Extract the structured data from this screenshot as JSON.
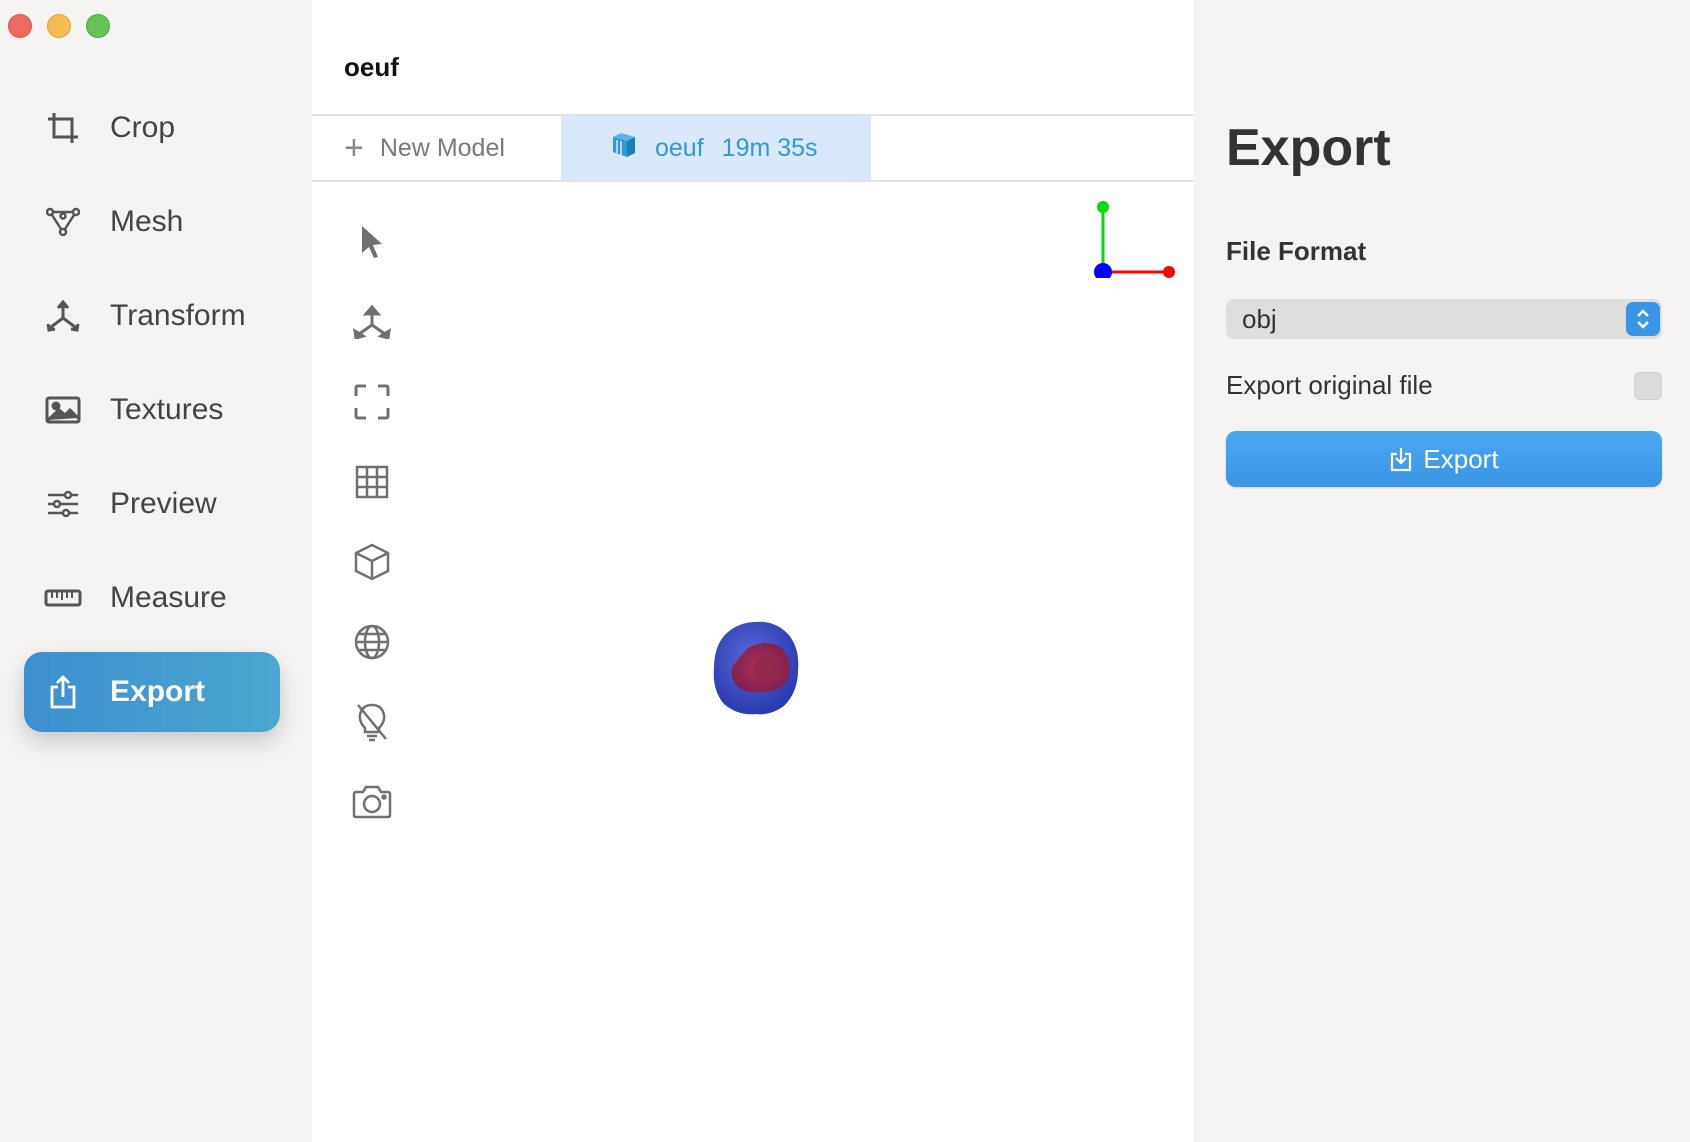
{
  "window": {
    "controls": [
      "close",
      "minimize",
      "zoom"
    ]
  },
  "sidebar": {
    "items": [
      {
        "label": "Crop",
        "icon": "crop-icon"
      },
      {
        "label": "Mesh",
        "icon": "mesh-icon"
      },
      {
        "label": "Transform",
        "icon": "transform-icon"
      },
      {
        "label": "Textures",
        "icon": "image-icon"
      },
      {
        "label": "Preview",
        "icon": "sliders-icon"
      },
      {
        "label": "Measure",
        "icon": "ruler-icon"
      },
      {
        "label": "Export",
        "icon": "share-icon",
        "active": true
      }
    ]
  },
  "main": {
    "title": "oeuf",
    "tabs": {
      "new_label": "New Model",
      "active_name": "oeuf",
      "active_time": "19m 35s"
    },
    "tools": [
      "pointer-icon",
      "transform-tool-icon",
      "frame-icon",
      "grid-icon",
      "cube-icon",
      "globe-icon",
      "light-off-icon",
      "camera-icon"
    ]
  },
  "panel": {
    "title": "Export",
    "file_format_label": "File Format",
    "file_format_value": "obj",
    "export_original_label": "Export original file",
    "export_original_checked": false,
    "export_button_label": "Export"
  },
  "colors": {
    "accent": "#3b95e6",
    "active_nav": "#4aa6cf",
    "tab_active_bg": "#d9e8fa",
    "axis_x": "#ff0000",
    "axis_y": "#00dd00",
    "axis_z": "#0000ff"
  }
}
